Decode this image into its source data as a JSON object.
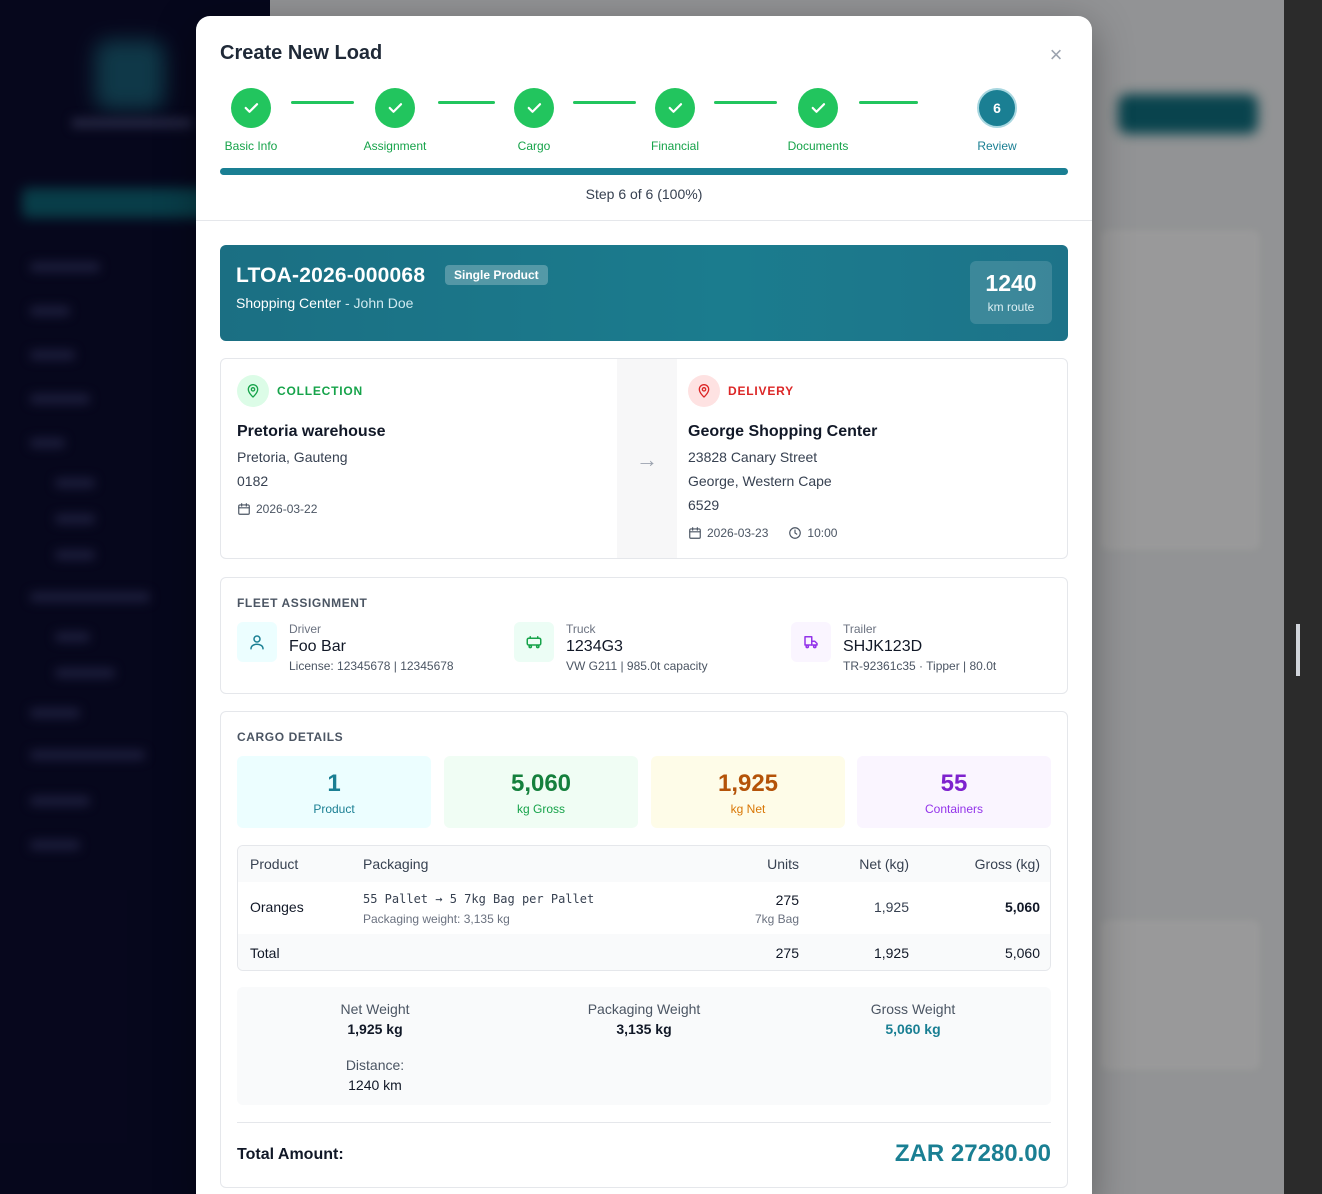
{
  "modal": {
    "title": "Create New Load",
    "close_label": "×"
  },
  "steps": [
    {
      "label": "Basic Info",
      "status": "complete"
    },
    {
      "label": "Assignment",
      "status": "complete"
    },
    {
      "label": "Cargo",
      "status": "complete"
    },
    {
      "label": "Financial",
      "status": "complete"
    },
    {
      "label": "Documents",
      "status": "complete"
    },
    {
      "label": "Review",
      "status": "current",
      "number": "6"
    }
  ],
  "progress": {
    "text": "Step 6 of 6 (100%)",
    "percent": 100
  },
  "load": {
    "id": "LTOA-2026-000068",
    "badge": "Single Product",
    "route_name": "Shopping Center",
    "separator": " - ",
    "customer": "John Doe",
    "distance_value": "1240",
    "distance_label": "km route"
  },
  "collection": {
    "tag": "COLLECTION",
    "name": "Pretoria warehouse",
    "address_line1": "Pretoria, Gauteng",
    "postal_code": "0182",
    "date": "2026-03-22"
  },
  "delivery": {
    "tag": "DELIVERY",
    "name": "George Shopping Center",
    "street": "23828 Canary Street",
    "city_province": "George, Western Cape",
    "postal_code": "6529",
    "date": "2026-03-23",
    "time": "10:00"
  },
  "route_arrow": "→",
  "fleet": {
    "title": "FLEET ASSIGNMENT",
    "driver": {
      "label": "Driver",
      "name": "Foo Bar",
      "detail": "License: 12345678 | 12345678"
    },
    "truck": {
      "label": "Truck",
      "name": "1234G3",
      "detail": "VW G211 | 985.0t capacity"
    },
    "trailer": {
      "label": "Trailer",
      "name": "SHJK123D",
      "detail": "TR-92361c35 · Tipper | 80.0t"
    }
  },
  "cargo": {
    "title": "CARGO DETAILS",
    "stats": [
      {
        "value": "1",
        "label": "Product"
      },
      {
        "value": "5,060",
        "label": "kg Gross"
      },
      {
        "value": "1,925",
        "label": "kg Net"
      },
      {
        "value": "55",
        "label": "Containers"
      }
    ],
    "table": {
      "headers": {
        "product": "Product",
        "packaging": "Packaging",
        "units": "Units",
        "net": "Net (kg)",
        "gross": "Gross (kg)"
      },
      "row": {
        "product": "Oranges",
        "packaging": "55 Pallet → 5 7kg Bag per Pallet",
        "packaging_weight": "Packaging weight: 3,135 kg",
        "units": "275",
        "unit_type": "7kg Bag",
        "net": "1,925",
        "gross": "5,060"
      },
      "total": {
        "label": "Total",
        "units": "275",
        "net": "1,925",
        "gross": "5,060"
      }
    },
    "summary": {
      "net_label": "Net Weight",
      "net_value": "1,925 kg",
      "packaging_label": "Packaging Weight",
      "packaging_value": "3,135 kg",
      "gross_label": "Gross Weight",
      "gross_value": "5,060 kg",
      "distance_label": "Distance:",
      "distance_value": "1240 km"
    },
    "total_amount_label": "Total Amount:",
    "total_amount_value": "ZAR 27280.00"
  },
  "colors": {
    "accent": "#1a7f93",
    "success": "#22c55e",
    "danger": "#dc2626",
    "sidebar": "#0b0c2e"
  }
}
